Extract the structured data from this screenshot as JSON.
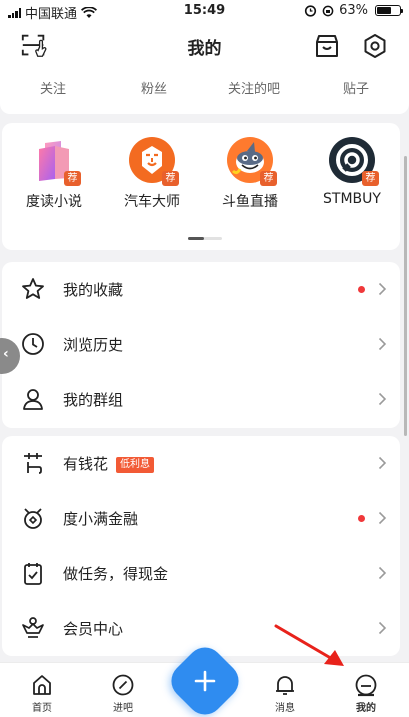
{
  "status_bar": {
    "carrier": "中国联通",
    "time": "15:49",
    "battery": "63%",
    "battery_level": 0.63
  },
  "header": {
    "title": "我的"
  },
  "stats": [
    "关注",
    "粉丝",
    "关注的吧",
    "贴子"
  ],
  "apps": [
    {
      "name": "度读小说",
      "tag": "荐",
      "icon": "book-logo-icon"
    },
    {
      "name": "汽车大师",
      "tag": "荐",
      "icon": "lion-logo-icon"
    },
    {
      "name": "斗鱼直播",
      "tag": "荐",
      "icon": "shark-logo-icon"
    },
    {
      "name": "STMBUY",
      "tag": "荐",
      "icon": "ring-logo-icon"
    }
  ],
  "menu_group1": [
    {
      "label": "我的收藏",
      "icon": "star-icon",
      "dot": true
    },
    {
      "label": "浏览历史",
      "icon": "clock-icon",
      "dot": false
    },
    {
      "label": "我的群组",
      "icon": "group-icon",
      "dot": false
    }
  ],
  "menu_group2": [
    {
      "label": "有钱花",
      "icon": "money-flower-icon",
      "badge": "低利息"
    },
    {
      "label": "度小满金融",
      "icon": "finance-icon",
      "dot": true
    },
    {
      "label": "做任务，得现金",
      "icon": "task-clipboard-icon"
    },
    {
      "label": "会员中心",
      "icon": "crown-icon"
    }
  ],
  "tabs": [
    {
      "label": "首页",
      "icon": "home-icon"
    },
    {
      "label": "进吧",
      "icon": "compass-icon"
    },
    {
      "label": "消息",
      "icon": "bell-icon"
    },
    {
      "label": "我的",
      "icon": "profile-icon"
    }
  ],
  "colors": {
    "accent_blue": "#2f8cf0",
    "tag_orange": "#e8602c",
    "dot_red": "#f0383a",
    "arrow_red": "#e8221b"
  }
}
